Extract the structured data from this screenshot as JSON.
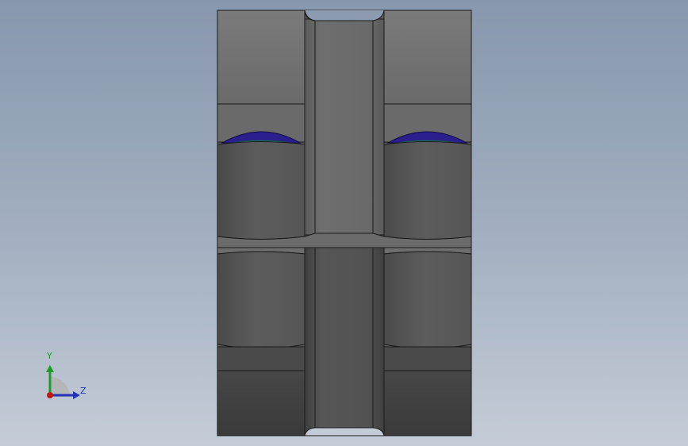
{
  "viewport": {
    "background_top": "#8797ad",
    "background_bottom": "#c4cdd7"
  },
  "model": {
    "body_color": "#5f5f5f",
    "body_light": "#6f6f6f",
    "body_dark": "#3d3d3d",
    "edge_color": "#1a1a1a",
    "lens_color": "#2a1f8c",
    "lens_inner_color": "#2f8f8f",
    "slot_color": "#c9c36a"
  },
  "triad": {
    "y_label": "Y",
    "z_label": "Z",
    "y_color": "#1f9b2a",
    "z_color": "#2433b8",
    "origin_color": "#c01818"
  }
}
